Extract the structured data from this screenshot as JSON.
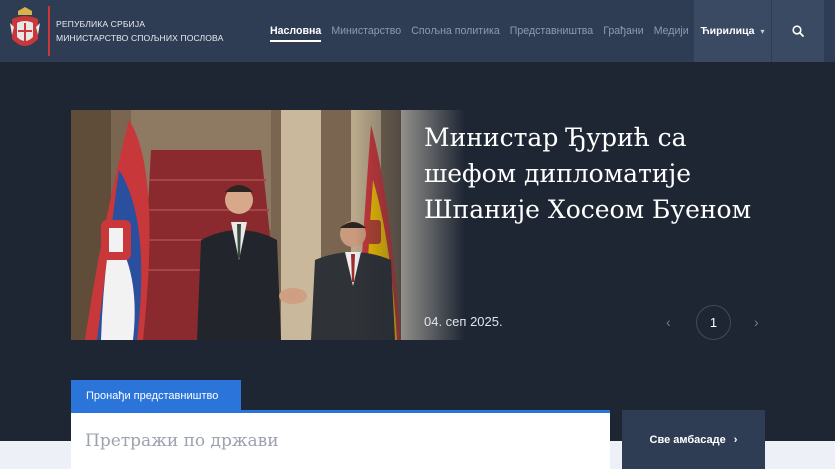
{
  "header": {
    "brand_line1": "РЕПУБЛИКА СРБИЈА",
    "brand_line2": "МИНИСТАРСТВО СПОЉНИХ ПОСЛОВА",
    "nav": [
      {
        "label": "Насловна",
        "active": true
      },
      {
        "label": "Министарство",
        "active": false
      },
      {
        "label": "Спољна политика",
        "active": false
      },
      {
        "label": "Представништва",
        "active": false
      },
      {
        "label": "Грађани",
        "active": false
      },
      {
        "label": "Медији",
        "active": false
      }
    ],
    "language": "Ћирилица",
    "search_icon": "search-icon"
  },
  "hero": {
    "title": "Министар Ђурић са шефом дипломатије Шпаније Хосеом Буеном",
    "date": "04. сеп 2025.",
    "page": "1"
  },
  "find": {
    "tab_label": "Пронађи представништво",
    "search_placeholder": "Претражи по држави",
    "all_button": "Све амбасаде"
  },
  "colors": {
    "header_bg": "#2f3d54",
    "page_bg": "#1e2633",
    "accent_blue": "#2b74d9",
    "brand_red": "#c8373a"
  }
}
